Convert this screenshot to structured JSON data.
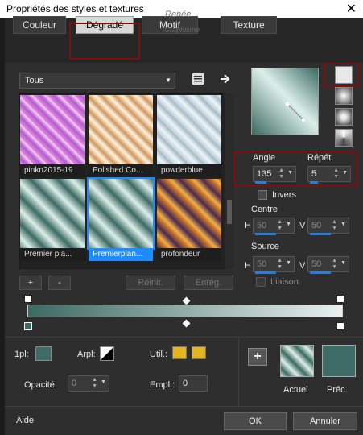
{
  "window": {
    "title": "Propriétés des styles et textures",
    "close_glyph": "✕"
  },
  "watermark": {
    "line1": "Renée",
    "line2": "Graphisme"
  },
  "tabs": [
    {
      "label": "Couleur"
    },
    {
      "label": "Dégradé"
    },
    {
      "label": "Motif"
    },
    {
      "label": "Texture"
    }
  ],
  "category": {
    "value": "Tous",
    "arrow": "▼"
  },
  "gallery": {
    "items": [
      {
        "caption": "pinkn2015-19"
      },
      {
        "caption": "Polished Co..."
      },
      {
        "caption": "powderblue"
      },
      {
        "caption": "Premier pla..."
      },
      {
        "caption": "Premierplan..."
      },
      {
        "caption": "profondeur"
      }
    ],
    "selected_index": 4
  },
  "gallery_buttons": {
    "add": "+",
    "remove": "-",
    "reset": "Réinit.",
    "save": "Enreg."
  },
  "gradient": {
    "angle_label": "Angle",
    "angle": "135",
    "repeat_label": "Répét.",
    "repeat": "5",
    "invert_label": "Invers",
    "center_label": "Centre",
    "center_h": "50",
    "center_v": "50",
    "source_label": "Source",
    "source_h": "50",
    "source_v": "50",
    "link_label": "Liaison",
    "h_label": "H",
    "v_label": "V"
  },
  "stops": {
    "location_label": "1pl:",
    "arrange_label": "Arpl:",
    "use_label": "Util.:",
    "opacity_label": "Opacité:",
    "opacity": "0",
    "position_label": "Empl.:",
    "position": "0",
    "use_color": "#e3b51e"
  },
  "swatches": {
    "current_label": "Actuel",
    "previous_label": "Préc.",
    "previous_color": "#3e6b65",
    "add": "+"
  },
  "footer": {
    "help": "Aide",
    "ok": "OK",
    "cancel": "Annuler"
  },
  "colors": {
    "gradient_dark": "#3b6a62",
    "gradient_light": "#e9f1ef",
    "accent": "#1e8cff",
    "highlight_box": "#7a1010"
  }
}
